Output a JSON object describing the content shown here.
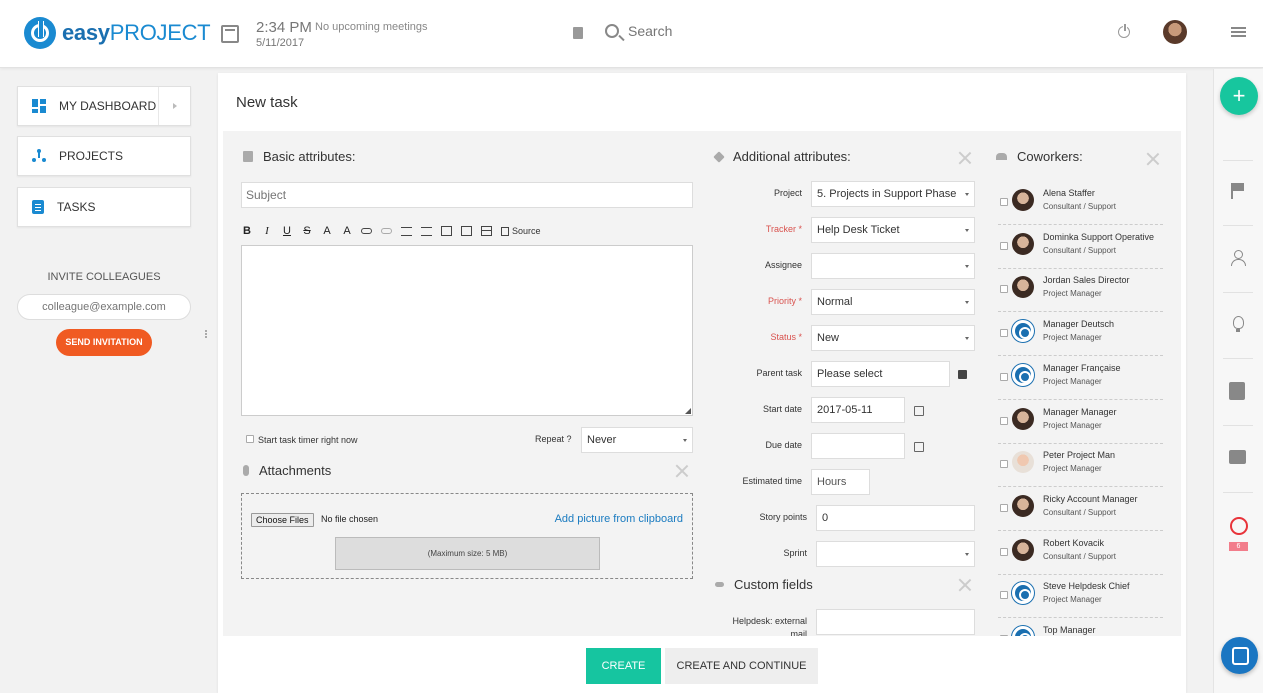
{
  "header": {
    "logo_bold": "easy",
    "logo_light": "PROJECT",
    "time": "2:34 PM",
    "meetings": "No upcoming meetings",
    "date": "5/11/2017",
    "search_placeholder": "Search"
  },
  "sidebar": {
    "items": [
      {
        "label": "MY DASHBOARD"
      },
      {
        "label": "PROJECTS"
      },
      {
        "label": "TASKS"
      }
    ],
    "invite_title": "INVITE COLLEAGUES",
    "invite_placeholder": "colleague@example.com",
    "invite_button": "SEND INVITATION"
  },
  "form": {
    "title": "New task",
    "basic_title": "Basic attributes:",
    "subject_placeholder": "Subject",
    "toolbar": {
      "bold": "B",
      "italic": "I",
      "underline": "U",
      "strike": "S",
      "font_color": "A",
      "bg_color": "A",
      "source": "Source"
    },
    "timer_label": "Start task timer right now",
    "repeat_label": "Repeat ?",
    "repeat_value": "Never",
    "attachments_title": "Attachments",
    "choose_files": "Choose Files",
    "no_file": "No file chosen",
    "clipboard_link": "Add picture from clipboard",
    "max_size": "(Maximum size: 5 MB)",
    "additional_title": "Additional attributes:",
    "fields": {
      "project": {
        "label": "Project",
        "value": "5. Projects in Support Phase"
      },
      "tracker": {
        "label": "Tracker *",
        "value": "Help Desk Ticket"
      },
      "assignee": {
        "label": "Assignee",
        "value": ""
      },
      "priority": {
        "label": "Priority *",
        "value": "Normal"
      },
      "status": {
        "label": "Status *",
        "value": "New"
      },
      "parent": {
        "label": "Parent task",
        "value": "Please select"
      },
      "start_date": {
        "label": "Start date",
        "value": "2017-05-11"
      },
      "due_date": {
        "label": "Due date",
        "value": ""
      },
      "estimated": {
        "label": "Estimated time",
        "placeholder": "Hours"
      },
      "story_points": {
        "label": "Story points",
        "value": "0"
      },
      "sprint": {
        "label": "Sprint",
        "value": ""
      }
    },
    "custom_title": "Custom fields",
    "helpdesk_label_1": "Helpdesk: external",
    "helpdesk_label_2": "mail",
    "coworkers_title": "Coworkers:",
    "coworkers": [
      {
        "name": "Alena Staffer",
        "role": "Consultant / Support",
        "avatar": "photo"
      },
      {
        "name": "Dominka Support Operative",
        "role": "Consultant / Support",
        "avatar": "photo"
      },
      {
        "name": "Jordan Sales Director",
        "role": "Project Manager",
        "avatar": "photo"
      },
      {
        "name": "Manager Deutsch",
        "role": "Project Manager",
        "avatar": "logo"
      },
      {
        "name": "Manager Française",
        "role": "Project Manager",
        "avatar": "logo"
      },
      {
        "name": "Manager Manager",
        "role": "Project Manager",
        "avatar": "photo"
      },
      {
        "name": "Peter Project Man",
        "role": "Project Manager",
        "avatar": "photo2"
      },
      {
        "name": "Ricky Account Manager",
        "role": "Consultant / Support",
        "avatar": "photo"
      },
      {
        "name": "Robert Kovacik",
        "role": "Consultant / Support",
        "avatar": "photo"
      },
      {
        "name": "Steve Helpdesk Chief",
        "role": "Project Manager",
        "avatar": "logo"
      },
      {
        "name": "Top Manager",
        "role": "",
        "avatar": "logo"
      }
    ],
    "create_button": "CREATE",
    "create_continue_button": "CREATE AND CONTINUE"
  },
  "right_sidebar": {
    "fab": "+",
    "alarm_badge": "6",
    "icons": [
      "flag-icon",
      "user-icon",
      "lightbulb-icon",
      "clipboard-icon",
      "chat-icon",
      "alarm-icon"
    ]
  },
  "colors": {
    "brand": "#1a8ad1",
    "invite_button": "#f05a22",
    "create_button": "#16c5a0",
    "fab": "#17c69e",
    "required_label": "#d9534f"
  }
}
